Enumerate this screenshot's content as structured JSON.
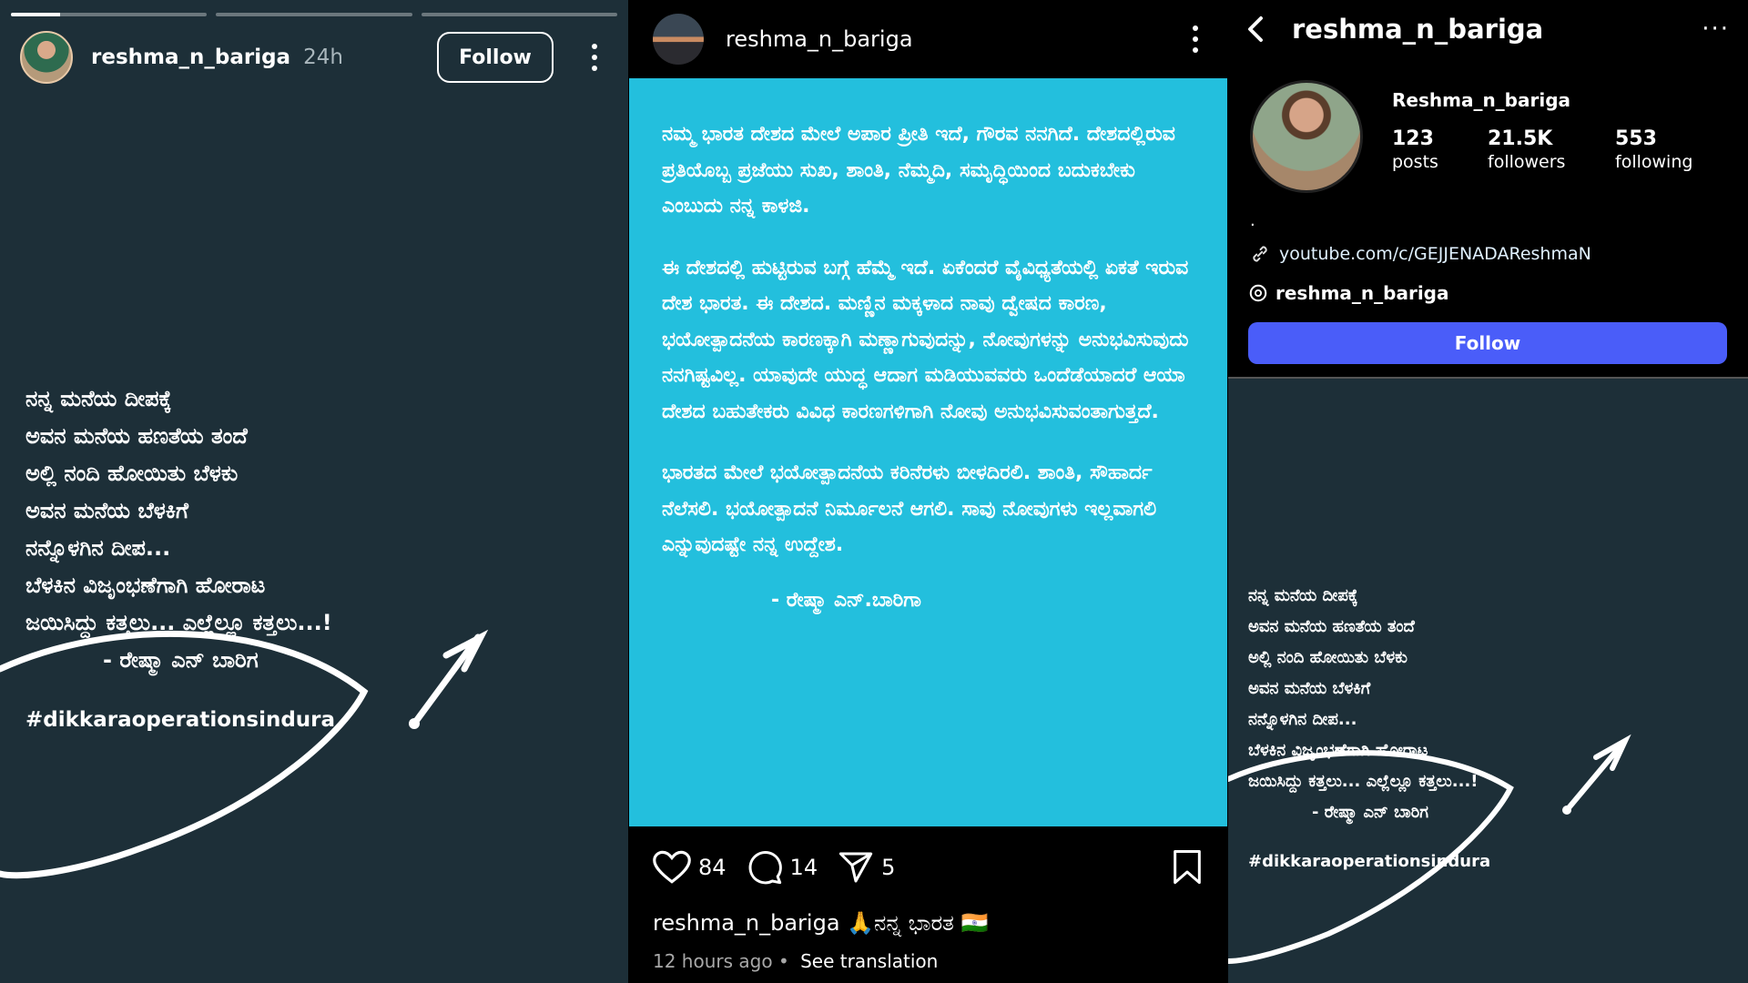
{
  "story": {
    "username": "reshma_n_bariga",
    "time": "24h",
    "follow_label": "Follow",
    "progress": [
      1,
      0,
      0
    ],
    "progress_current_fraction": 0.25,
    "poem_lines": [
      "ನನ್ನ ಮನೆಯ ದೀಪಕ್ಕೆ",
      "ಅವನ ಮನೆಯ ಹಣತೆಯ ತಂದೆ",
      "ಅಲ್ಲಿ ನಂದಿ ಹೋಯಿತು ಬೆಳಕು",
      "ಅವನ ಮನೆಯ ಬೆಳಕಿಗೆ",
      "ನನ್ನೊಳಗಿನ ದೀಪ...",
      "ಬೆಳಕಿನ ವಿಜೃಂಭಣೆಗಾಗಿ ಹೋರಾಟ",
      "ಜಯಿಸಿದ್ದು ಕತ್ತಲು... ಎಲ್ಲೆಲ್ಲೂ ಕತ್ತಲು...!"
    ],
    "signature": "- ರೇಷ್ಮಾ ಎನ್ ಬಾರಿಗ",
    "hashtag": "#dikkaraoperationsindura"
  },
  "post": {
    "username": "reshma_n_bariga",
    "paragraphs": [
      "ನಮ್ಮ ಭಾರತ ದೇಶದ ಮೇಲೆ ಅಪಾರ ಪ್ರೀತಿ ಇದೆ, ಗೌರವ ನನಗಿದೆ. ದೇಶದಲ್ಲಿರುವ ಪ್ರತಿಯೊಬ್ಬ ಪ್ರಜೆಯು ಸುಖ, ಶಾಂತಿ, ನೆಮ್ಮದಿ, ಸಮೃದ್ಧಿಯಿಂದ ಬದುಕಬೇಕು ಎಂಬುದು ನನ್ನ ಕಾಳಜಿ.",
      "ಈ ದೇಶದಲ್ಲಿ ಹುಟ್ಟಿರುವ ಬಗ್ಗೆ ಹೆಮ್ಮೆ ಇದೆ. ಏಕೆಂದರೆ ವೈವಿಧ್ಯತೆಯಲ್ಲಿ ಏಕತೆ ಇರುವ ದೇಶ ಭಾರತ. ಈ ದೇಶದ. ಮಣ್ಣಿನ ಮಕ್ಕಳಾದ ನಾವು ದ್ವೇಷದ ಕಾರಣ, ಭಯೋತ್ಪಾದನೆಯ ಕಾರಣಕ್ಕಾಗಿ ಮಣ್ಣಾಗುವುದನ್ನು, ನೋವುಗಳನ್ನು ಅನುಭವಿಸುವುದು ನನಗಿಷ್ಟವಿಲ್ಲ. ಯಾವುದೇ ಯುದ್ಧ ಆದಾಗ ಮಡಿಯುವವರು ಒಂದೆಡೆಯಾದರೆ ಆಯಾ ದೇಶದ ಬಹುತೇಕರು ವಿವಿಧ ಕಾರಣಗಳಿಗಾಗಿ ನೋವು ಅನುಭವಿಸುವಂತಾಗುತ್ತದೆ.",
      "ಭಾರತದ ಮೇಲೆ ಭಯೋತ್ಪಾದನೆಯ ಕರಿನೆರಳು ಬೀಳದಿರಲಿ. ಶಾಂತಿ, ಸೌಹಾರ್ದ ನೆಲೆಸಲಿ. ಭಯೋತ್ಪಾದನೆ ನಿರ್ಮೂಲನೆ ಆಗಲಿ. ಸಾವು ನೋವುಗಳು ಇಲ್ಲವಾಗಲಿ ಎನ್ನುವುದಷ್ಟೇ ನನ್ನ ಉದ್ದೇಶ."
    ],
    "signature": "- ರೇಷ್ಮಾ ಎನ್.ಬಾರಿಗಾ",
    "likes": "84",
    "comments": "14",
    "shares": "5",
    "caption_user": "reshma_n_bariga",
    "caption_text": " 🙏ನನ್ನ ಭಾರತ 🇮🇳",
    "time": "12 hours ago",
    "separator": "•",
    "see_translation": "See translation"
  },
  "profile": {
    "title": "reshma_n_bariga",
    "name": "Reshma_n_bariga",
    "posts_count": "123",
    "posts_label": "posts",
    "followers_count": "21.5K",
    "followers_label": "followers",
    "following_count": "553",
    "following_label": "following",
    "bio": ".",
    "link": "youtube.com/c/GEJJENADAReshmaN",
    "threads_handle": "reshma_n_bariga",
    "follow_label": "Follow",
    "follow_color": "#4a5df9"
  },
  "icons": [
    "heart-icon",
    "comment-icon",
    "send-icon",
    "bookmark-icon",
    "back-icon",
    "link-icon",
    "threads-icon",
    "more-icon"
  ]
}
